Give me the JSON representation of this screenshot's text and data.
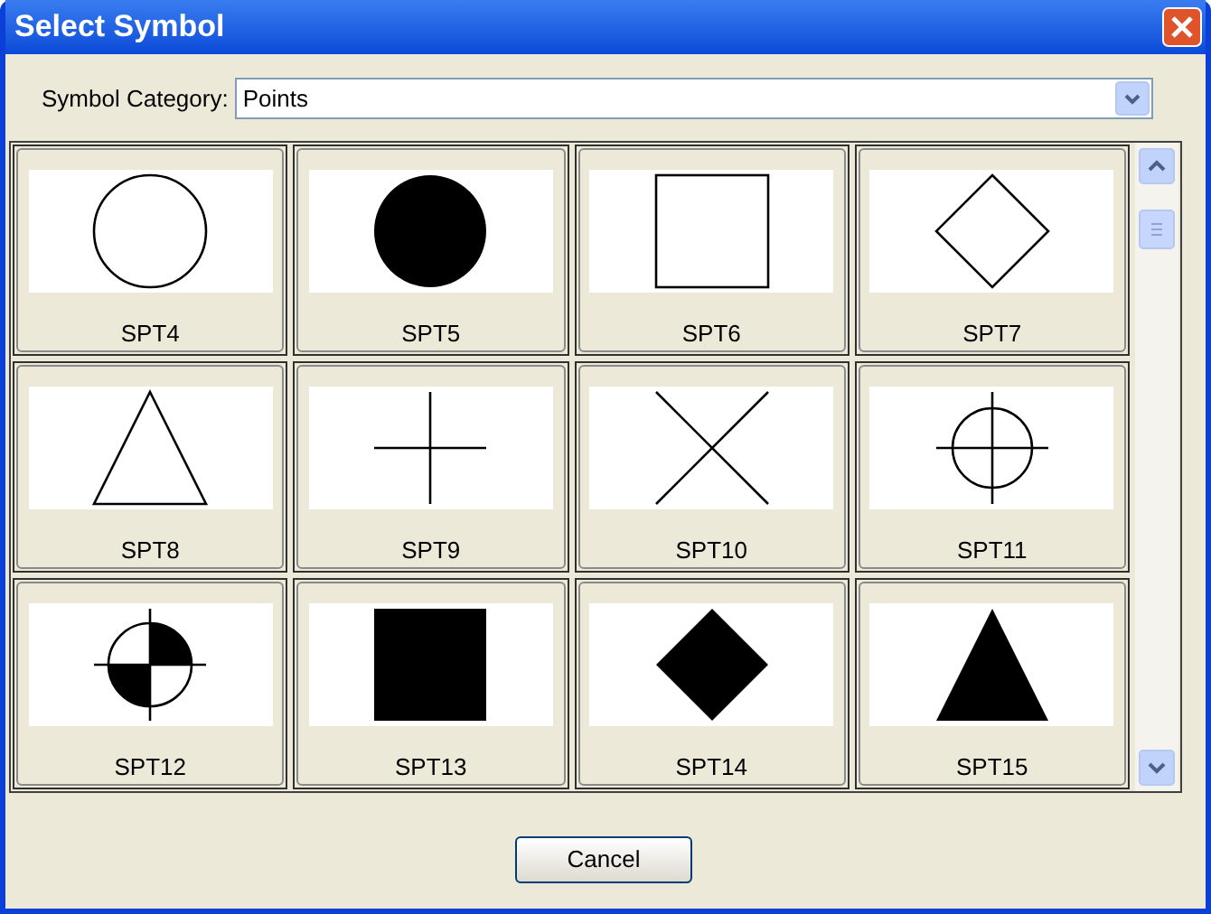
{
  "window": {
    "title": "Select Symbol"
  },
  "category": {
    "label": "Symbol Category:",
    "value": "Points"
  },
  "symbols": [
    {
      "label": "SPT4",
      "kind": "circle"
    },
    {
      "label": "SPT5",
      "kind": "disc"
    },
    {
      "label": "SPT6",
      "kind": "square"
    },
    {
      "label": "SPT7",
      "kind": "diamond"
    },
    {
      "label": "SPT8",
      "kind": "triangle"
    },
    {
      "label": "SPT9",
      "kind": "plus"
    },
    {
      "label": "SPT10",
      "kind": "cross"
    },
    {
      "label": "SPT11",
      "kind": "crosshair"
    },
    {
      "label": "SPT12",
      "kind": "quartered"
    },
    {
      "label": "SPT13",
      "kind": "filled-square"
    },
    {
      "label": "SPT14",
      "kind": "filled-diamond"
    },
    {
      "label": "SPT15",
      "kind": "filled-triangle"
    }
  ],
  "buttons": [
    "Cancel"
  ]
}
